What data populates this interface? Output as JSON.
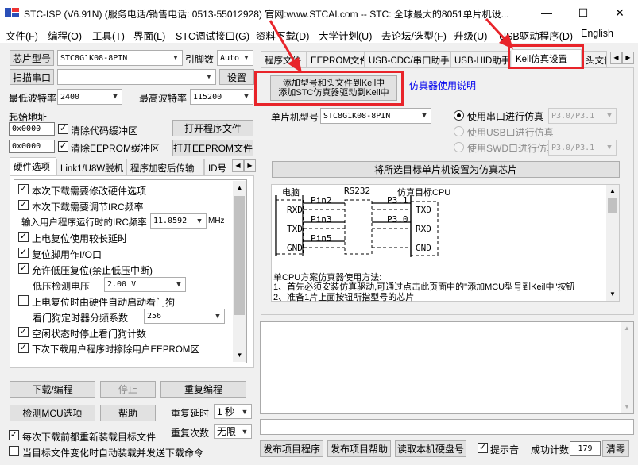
{
  "window": {
    "title": "STC-ISP (V6.91N) (服务电话/销售电话: 0513-55012928) 官网:www.STCAI.com  -- STC: 全球最大的8051单片机设...",
    "minimize": "—",
    "maximize": "☐",
    "close": "✕"
  },
  "menu": {
    "items": [
      "文件(F)",
      "编程(O)",
      "工具(T)",
      "界面(L)",
      "STC调试接口(G)",
      "资料下载(D)",
      "大学计划(U)",
      "去论坛/选型(F)",
      "升级(U)",
      "USB驱动程序(D)",
      "English"
    ]
  },
  "left": {
    "chip_button": "芯片型号",
    "chip_value": "STC8G1K08-8PIN",
    "pin_label": "引脚数",
    "pin_value": "Auto",
    "scan_button": "扫描串口",
    "port_value": "",
    "settings_button": "设置",
    "min_baud_label": "最低波特率",
    "min_baud_value": "2400",
    "max_baud_label": "最高波特率",
    "max_baud_value": "115200",
    "start_addr_label": "起始地址",
    "addr1": "0x0000",
    "clear_code": "清除代码缓冲区",
    "open_program": "打开程序文件",
    "addr2": "0x0000",
    "clear_eeprom": "清除EEPROM缓冲区",
    "open_eeprom": "打开EEPROM文件",
    "tabs": [
      "硬件选项",
      "Link1/U8W脱机",
      "程序加密后传输",
      "ID号"
    ],
    "options": [
      {
        "checked": true,
        "label": "本次下载需要修改硬件选项"
      },
      {
        "checked": true,
        "label": "本次下载需要调节IRC频率"
      },
      {
        "checked": true,
        "label": "上电复位使用较长延时"
      },
      {
        "checked": true,
        "label": "复位脚用作I/O口"
      },
      {
        "checked": true,
        "label": "允许低压复位(禁止低压中断)"
      },
      {
        "checked": false,
        "label": "上电复位时由硬件自动启动看门狗"
      },
      {
        "checked": true,
        "label": "空闲状态时停止看门狗计数"
      },
      {
        "checked": true,
        "label": "下次下载用户程序时擦除用户EEPROM区"
      }
    ],
    "irc_label": "输入用户程序运行时的IRC频率",
    "irc_value": "11.0592",
    "irc_unit": "MHz",
    "lv_label": "低压检测电压",
    "lv_value": "2.00 V",
    "wdt_label": "看门狗定时器分频系数",
    "wdt_value": "256",
    "download_button": "下载/编程",
    "stop_button": "停止",
    "reprogram_button": "重复编程",
    "detect_button": "检测MCU选项",
    "help_button": "帮助",
    "repeat_delay_label": "重复延时",
    "repeat_delay_value": "1 秒",
    "repeat_count_label": "重复次数",
    "repeat_count_value": "无限",
    "reload_check": "每次下载前都重新装载目标文件",
    "auto_check": "当目标文件变化时自动装载并发送下载命令"
  },
  "right": {
    "tabs": [
      "程序文件",
      "EEPROM文件",
      "USB-CDC/串口助手",
      "USB-HID助手",
      "Keil仿真设置",
      "头文件"
    ],
    "add_keil_line1": "添加型号和头文件到Keil中",
    "add_keil_line2": "添加STC仿真器驱动到Keil中",
    "emulator_link": "仿真器使用说明",
    "mcu_label": "单片机型号",
    "mcu_value": "STC8G1K08-8PIN",
    "radio_serial": "使用串口进行仿真",
    "radio_serial_value": "P3.0/P3.1",
    "radio_usb": "使用USB口进行仿真",
    "radio_swd": "使用SWD口进行仿真",
    "radio_swd_value": "P3.0/P3.1",
    "set_chip_button": "将所选目标单片机设置为仿真芯片",
    "diagram": {
      "pc": "电脑",
      "rs232": "RS232",
      "target": "仿真目标CPU",
      "rxd": "RXD",
      "txd": "TXD",
      "gnd": "GND",
      "pin2": "Pin2",
      "pin3": "Pin3",
      "pin5": "Pin5",
      "p31": "P3.1",
      "p30": "P3.0",
      "t_txd": "TXD",
      "t_rxd": "RXD",
      "t_gnd": "GND"
    },
    "method_title": "单CPU方案仿真器使用方法:",
    "method_1": "1、首先必须安装仿真驱动,可通过点击此页面中的\"添加MCU型号到Keil中\"按钮",
    "method_2": "2、准备1片上面按钮所指型号的芯片",
    "publish_program": "发布项目程序",
    "publish_help": "发布项目帮助",
    "read_disk": "读取本机硬盘号",
    "sound_label": "提示音",
    "success_label": "成功计数",
    "success_value": "179",
    "clear_button": "清零"
  },
  "colors": {
    "highlight": "#e8242a",
    "link": "#0000ee"
  }
}
